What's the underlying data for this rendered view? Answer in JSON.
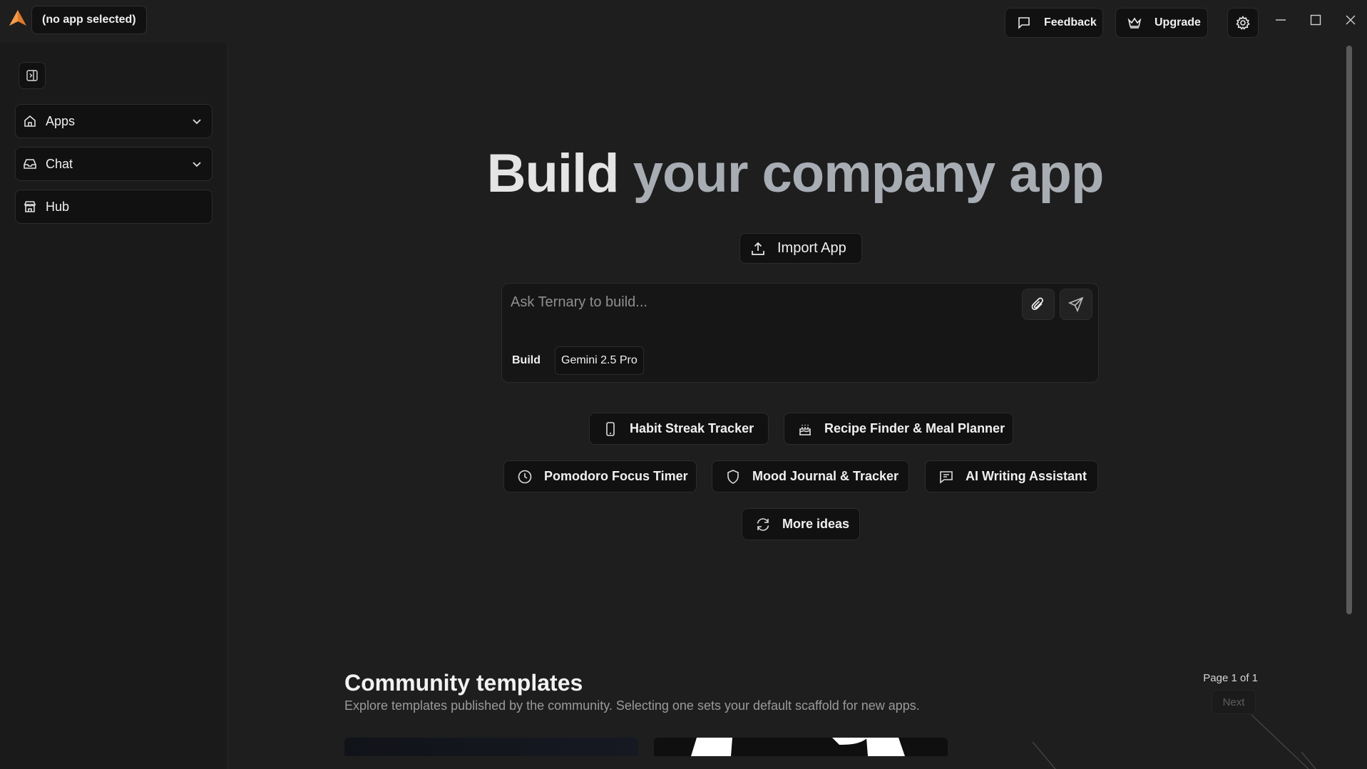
{
  "titlebar": {
    "app_selector": "(no app selected)",
    "feedback_label": "Feedback",
    "upgrade_label": "Upgrade",
    "icons": [
      "app-logo-icon",
      "feedback-icon",
      "crown-icon",
      "gear-icon",
      "minimize-icon",
      "maximize-icon",
      "close-icon"
    ]
  },
  "sidebar": {
    "items": [
      {
        "label": "Apps",
        "icon": "home-icon",
        "expandable": true
      },
      {
        "label": "Chat",
        "icon": "inbox-icon",
        "expandable": true
      },
      {
        "label": "Hub",
        "icon": "store-icon",
        "expandable": false
      }
    ]
  },
  "hero": {
    "title_part1": "Build",
    "title_part2": "your company app",
    "import_label": "Import App"
  },
  "prompt": {
    "placeholder": "Ask Ternary to build...",
    "mode_label": "Build",
    "model_label": "Gemini 2.5 Pro"
  },
  "ideas": {
    "row1": [
      {
        "label": "Habit Streak Tracker",
        "icon": "smartphone-icon"
      },
      {
        "label": "Recipe Finder & Meal Planner",
        "icon": "cake-icon"
      }
    ],
    "row2": [
      {
        "label": "Pomodoro Focus Timer",
        "icon": "clock-icon"
      },
      {
        "label": "Mood Journal & Tracker",
        "icon": "shield-icon"
      },
      {
        "label": "AI Writing Assistant",
        "icon": "message-icon"
      }
    ],
    "more_label": "More ideas"
  },
  "community": {
    "title": "Community templates",
    "description": "Explore templates published by the community. Selecting one sets your default scaffold for new apps.",
    "page_info": "Page 1 of 1",
    "next_label": "Next"
  },
  "colors": {
    "background": "#1e1e1e",
    "sidebar": "#1a1a1a",
    "button_bg": "#111111",
    "accent_logo": "#e07a2a",
    "title_accent": "#a8adb4"
  }
}
